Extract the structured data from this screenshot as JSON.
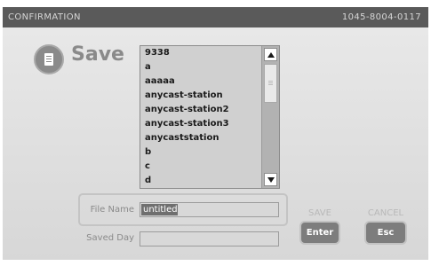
{
  "titlebar": {
    "title": "CONFIRMATION",
    "code": "1045-8004-0117"
  },
  "header": {
    "title": "Save",
    "icon": "document-icon"
  },
  "file_list": {
    "items": [
      "9338",
      "a",
      "aaaaa",
      "anycast-station",
      "anycast-station2",
      "anycast-station3",
      "anycaststation",
      "b",
      "c",
      "d"
    ]
  },
  "form": {
    "file_name_label": "File Name",
    "file_name_value": "untitled",
    "saved_day_label": "Saved Day",
    "saved_day_value": ""
  },
  "actions": {
    "save_label": "SAVE",
    "save_key": "Enter",
    "cancel_label": "CANCEL",
    "cancel_key": "Esc"
  }
}
